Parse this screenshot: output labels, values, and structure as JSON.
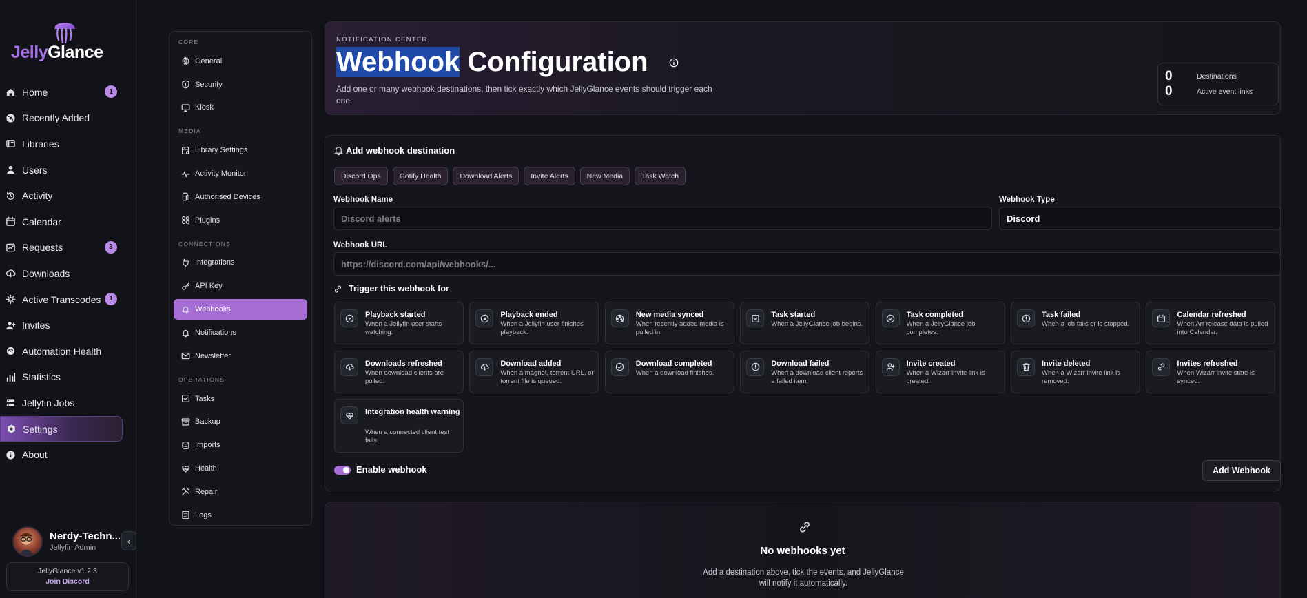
{
  "brand": {
    "part1": "Jelly",
    "part2": "Glance"
  },
  "nav": {
    "items": [
      {
        "label": "Home",
        "icon": "home-icon",
        "badge": "1"
      },
      {
        "label": "Recently Added",
        "icon": "recent-icon",
        "badge": ""
      },
      {
        "label": "Libraries",
        "icon": "library-icon",
        "badge": ""
      },
      {
        "label": "Users",
        "icon": "user-icon",
        "badge": ""
      },
      {
        "label": "Activity",
        "icon": "history-icon",
        "badge": ""
      },
      {
        "label": "Calendar",
        "icon": "calendar-icon",
        "badge": ""
      },
      {
        "label": "Requests",
        "icon": "requests-icon",
        "badge": "3"
      },
      {
        "label": "Downloads",
        "icon": "cloud-download-icon",
        "badge": ""
      },
      {
        "label": "Active Transcodes",
        "icon": "transcode-icon",
        "badge": "1"
      },
      {
        "label": "Invites",
        "icon": "invite-icon",
        "badge": ""
      },
      {
        "label": "Automation Health",
        "icon": "automation-icon",
        "badge": ""
      },
      {
        "label": "Statistics",
        "icon": "statistics-icon",
        "badge": ""
      },
      {
        "label": "Jellyfin Jobs",
        "icon": "jobs-icon",
        "badge": ""
      },
      {
        "label": "Settings",
        "icon": "settings-icon",
        "badge": "",
        "active": true
      },
      {
        "label": "About",
        "icon": "about-icon",
        "badge": ""
      }
    ]
  },
  "profile": {
    "name": "Nerdy-Techn...",
    "role": "Jellyfin Admin",
    "collapse": "‹"
  },
  "footer": {
    "version": "JellyGlance v1.2.3",
    "discord": "Join Discord"
  },
  "subnav": {
    "groups": [
      {
        "label": "CORE",
        "items": [
          {
            "label": "General",
            "icon": "gear-icon"
          },
          {
            "label": "Security",
            "icon": "shield-icon"
          },
          {
            "label": "Kiosk",
            "icon": "monitor-icon"
          }
        ]
      },
      {
        "label": "MEDIA",
        "items": [
          {
            "label": "Library Settings",
            "icon": "library-settings-icon"
          },
          {
            "label": "Activity Monitor",
            "icon": "pulse-icon"
          },
          {
            "label": "Authorised Devices",
            "icon": "devices-icon"
          },
          {
            "label": "Plugins",
            "icon": "plugins-icon"
          }
        ]
      },
      {
        "label": "CONNECTIONS",
        "items": [
          {
            "label": "Integrations",
            "icon": "plug-icon"
          },
          {
            "label": "API Key",
            "icon": "key-icon"
          },
          {
            "label": "Webhooks",
            "icon": "bell-icon",
            "active": true
          },
          {
            "label": "Notifications",
            "icon": "bell-icon"
          },
          {
            "label": "Newsletter",
            "icon": "mail-icon"
          }
        ]
      },
      {
        "label": "OPERATIONS",
        "items": [
          {
            "label": "Tasks",
            "icon": "check-square-icon"
          },
          {
            "label": "Backup",
            "icon": "archive-icon"
          },
          {
            "label": "Imports",
            "icon": "database-icon"
          },
          {
            "label": "Health",
            "icon": "heart-pulse-icon"
          },
          {
            "label": "Repair",
            "icon": "tools-icon"
          },
          {
            "label": "Logs",
            "icon": "logs-icon"
          }
        ]
      }
    ]
  },
  "header": {
    "eyebrow": "NOTIFICATION CENTER",
    "title_highlight": "Webhook",
    "title_rest": " Configuration",
    "description": "Add one or many webhook destinations, then tick exactly which JellyGlance events should trigger each one.",
    "stats": [
      {
        "value": "0",
        "label": "Destinations"
      },
      {
        "value": "0",
        "label": "Active event links"
      }
    ]
  },
  "form": {
    "section_title": "Add webhook destination",
    "presets": [
      "Discord Ops",
      "Gotify Health",
      "Download Alerts",
      "Invite Alerts",
      "New Media",
      "Task Watch"
    ],
    "name_label": "Webhook Name",
    "name_placeholder": "Discord alerts",
    "type_label": "Webhook Type",
    "type_value": "Discord",
    "url_label": "Webhook URL",
    "url_placeholder": "https://discord.com/api/webhooks/...",
    "trigger_title": "Trigger this webhook for",
    "events": [
      {
        "title": "Playback started",
        "desc": "When a Jellyfin user starts watching.",
        "icon": "play-icon"
      },
      {
        "title": "Playback ended",
        "desc": "When a Jellyfin user finishes playback.",
        "icon": "stop-icon"
      },
      {
        "title": "New media synced",
        "desc": "When recently added media is pulled in.",
        "icon": "film-reel-icon"
      },
      {
        "title": "Task started",
        "desc": "When a JellyGlance job begins.",
        "icon": "task-icon"
      },
      {
        "title": "Task completed",
        "desc": "When a JellyGlance job completes.",
        "icon": "check-circle-icon"
      },
      {
        "title": "Task failed",
        "desc": "When a job fails or is stopped.",
        "icon": "alert-circle-icon"
      },
      {
        "title": "Calendar refreshed",
        "desc": "When Arr release data is pulled into Calendar.",
        "icon": "calendar-icon"
      },
      {
        "title": "Downloads refreshed",
        "desc": "When download clients are polled.",
        "icon": "cloud-download-icon"
      },
      {
        "title": "Download added",
        "desc": "When a magnet, torrent URL, or torrent file is queued.",
        "icon": "cloud-download-icon"
      },
      {
        "title": "Download completed",
        "desc": "When a download finishes.",
        "icon": "check-circle-icon"
      },
      {
        "title": "Download failed",
        "desc": "When a download client reports a failed item.",
        "icon": "alert-circle-icon"
      },
      {
        "title": "Invite created",
        "desc": "When a Wizarr invite link is created.",
        "icon": "user-plus-icon"
      },
      {
        "title": "Invite deleted",
        "desc": "When a Wizarr invite link is removed.",
        "icon": "trash-icon"
      },
      {
        "title": "Invites refreshed",
        "desc": "When Wizarr invite state is synced.",
        "icon": "link-icon"
      },
      {
        "title": "Integration health warning",
        "desc": "When a connected client test fails.",
        "icon": "heart-pulse-icon"
      }
    ],
    "enable_label": "Enable webhook",
    "add_button": "Add Webhook"
  },
  "empty": {
    "title": "No webhooks yet",
    "description": "Add a destination above, tick the events, and JellyGlance will notify it automatically."
  },
  "colors": {
    "accent": "#a66ed4",
    "background": "#111318",
    "card": "#14161b"
  }
}
